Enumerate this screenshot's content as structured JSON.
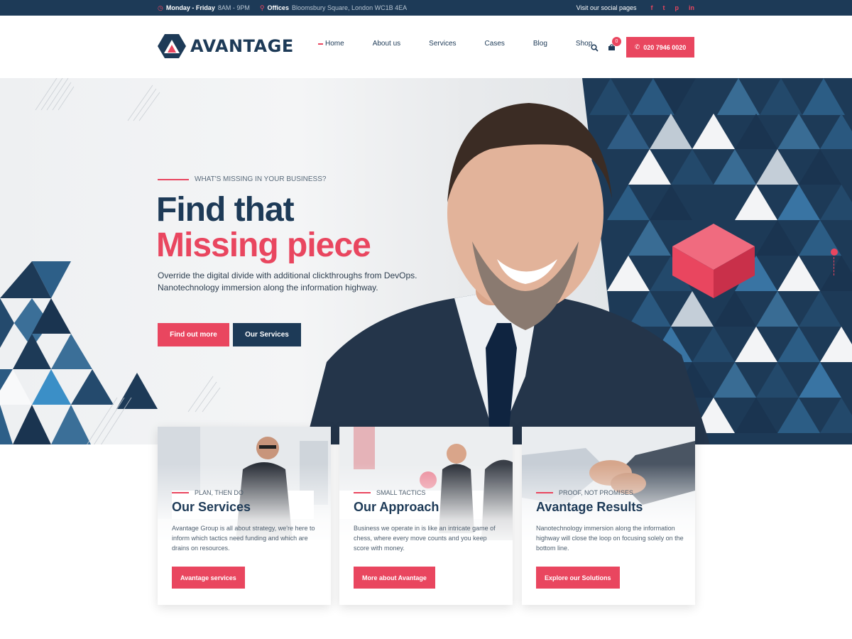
{
  "topbar": {
    "hours_label": "Monday - Friday",
    "hours_value": "8AM - 9PM",
    "offices_label": "Offices",
    "offices_value": "Bloomsbury Square, London WC1B 4EA",
    "social_label": "Visit our social pages",
    "social_icons": [
      "facebook-icon",
      "twitter-icon",
      "pinterest-icon",
      "linkedin-icon"
    ],
    "social_glyphs": [
      "f",
      "t",
      "p",
      "in"
    ]
  },
  "header": {
    "logo_text": "AVANTAGE",
    "nav": [
      "Home",
      "About us",
      "Services",
      "Cases",
      "Blog",
      "Shop"
    ],
    "cart_count": "0",
    "phone": "020 7946 0020"
  },
  "hero": {
    "eyebrow": "WHAT'S MISSING IN YOUR BUSINESS?",
    "title_line1": "Find that",
    "title_line2": "Missing piece",
    "description": "Override the digital divide with additional clickthroughs from DevOps. Nanotechnology immersion along the information highway.",
    "button_primary": "Find out more",
    "button_secondary": "Our Services"
  },
  "cards": [
    {
      "eyebrow": "PLAN, THEN DO",
      "title": "Our Services",
      "text": "Avantage Group is all about strategy, we're here to inform which tactics need funding and which are drains on resources.",
      "button": "Avantage services"
    },
    {
      "eyebrow": "SMALL TACTICS",
      "title": "Our Approach",
      "text": "Business we operate in is like an intricate game of chess, where every move counts and you keep score with money.",
      "button": "More about Avantage"
    },
    {
      "eyebrow": "PROOF, NOT PROMISES",
      "title": "Avantage Results",
      "text": "Nanotechnology immersion along the information highway will close the loop on focusing solely on the bottom line.",
      "button": "Explore our Solutions"
    }
  ],
  "colors": {
    "navy": "#1d3a57",
    "accent": "#e9465f",
    "blue": "#3b78a8"
  }
}
